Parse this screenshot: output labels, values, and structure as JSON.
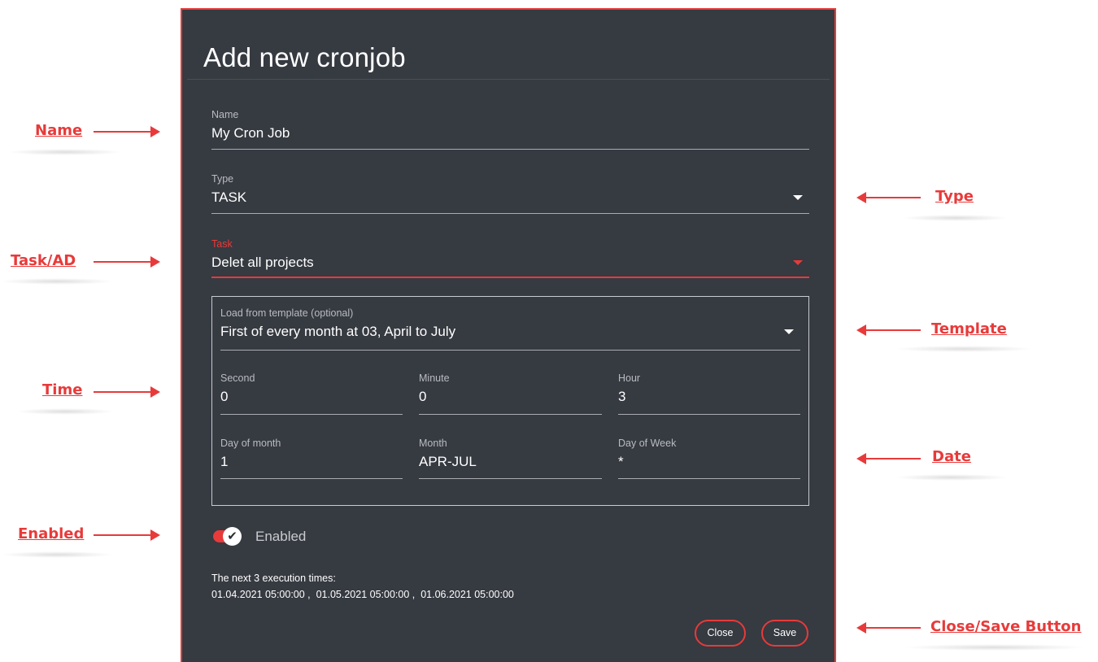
{
  "dialog": {
    "title": "Add new cronjob",
    "name": {
      "label": "Name",
      "value": "My Cron Job"
    },
    "type": {
      "label": "Type",
      "value": "TASK"
    },
    "task": {
      "label": "Task",
      "value": "Delet all projects"
    },
    "template": {
      "label": "Load from template (optional)",
      "value": "First of every month at 03, April to July"
    },
    "second": {
      "label": "Second",
      "value": "0"
    },
    "minute": {
      "label": "Minute",
      "value": "0"
    },
    "hour": {
      "label": "Hour",
      "value": "3"
    },
    "day_of_month": {
      "label": "Day of month",
      "value": "1"
    },
    "month": {
      "label": "Month",
      "value": "APR-JUL"
    },
    "day_of_week": {
      "label": "Day of Week",
      "value": "*"
    },
    "enabled": {
      "label": "Enabled",
      "checked": true
    },
    "execution": {
      "heading": "The next 3 execution times:",
      "times": [
        "01.04.2021 05:00:00 ,  ",
        "01.05.2021 05:00:00 ,  ",
        "01.06.2021 05:00:00"
      ]
    },
    "buttons": {
      "close": "Close",
      "save": "Save"
    }
  },
  "annotations": {
    "name": "Name",
    "task_ad": "Task/AD",
    "time": "Time",
    "enabled": "Enabled",
    "type": "Type",
    "template": "Template",
    "date": "Date",
    "close_save": "Close/Save Button"
  },
  "colors": {
    "accent": "#e83a3a",
    "dialog_bg": "#363a41",
    "text": "#ffffff"
  },
  "icons": {
    "dropdown": "caret-down-icon",
    "toggle_check": "check-icon",
    "arrow": "arrow-icon"
  }
}
